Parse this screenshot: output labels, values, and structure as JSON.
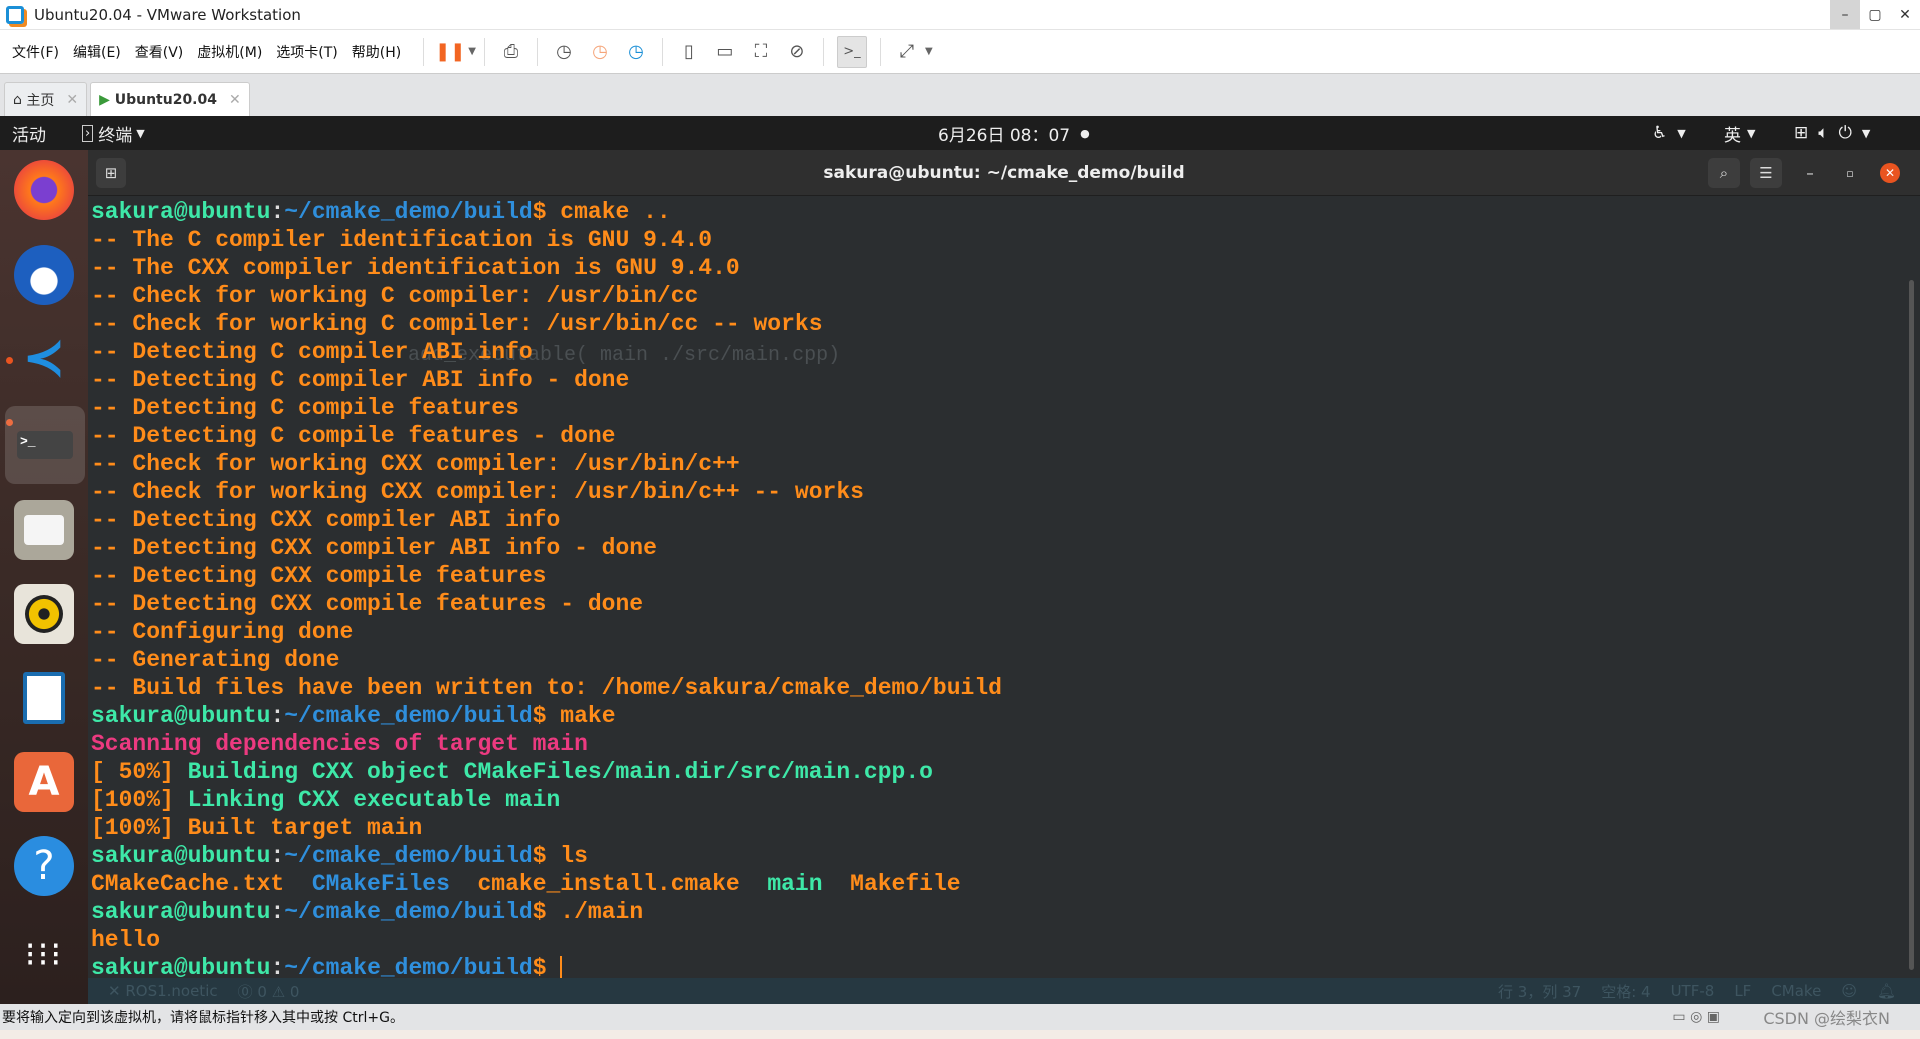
{
  "window": {
    "title": "Ubuntu20.04 - VMware Workstation",
    "controls": [
      "–",
      "▢",
      "✕"
    ]
  },
  "menu": [
    "文件(F)",
    "编辑(E)",
    "查看(V)",
    "虚拟机(M)",
    "选项卡(T)",
    "帮助(H)"
  ],
  "toolbar_icons": [
    "pause-icon",
    "send-ctrl-alt-del-icon",
    "snapshot-icon",
    "revert-snapshot-icon",
    "snapshot-manager-icon",
    "sidebar-view-icon",
    "thumbnail-view-icon",
    "fullscreen-icon",
    "unity-icon",
    "console-view-icon",
    "stretch-icon"
  ],
  "tabs": [
    {
      "label": "主页",
      "icon": "home-icon"
    },
    {
      "label": "Ubuntu20.04",
      "icon": "vm-icon",
      "active": true
    }
  ],
  "gnome": {
    "activities": "活动",
    "app_menu": "终端",
    "clock": "6月26日 08：07",
    "input_method": "英"
  },
  "terminal": {
    "title": "sakura@ubuntu: ~/cmake_demo/build",
    "ghost_text": "add_executable( main ./src/main.cpp)",
    "lines": [
      [
        [
          "g",
          "sakura@ubuntu"
        ],
        [
          "w",
          ":"
        ],
        [
          "b",
          "~/cmake_demo/build"
        ],
        [
          "o",
          "$ cmake .."
        ]
      ],
      [
        [
          "o",
          "-- The C compiler identification is GNU 9.4.0"
        ]
      ],
      [
        [
          "o",
          "-- The CXX compiler identification is GNU 9.4.0"
        ]
      ],
      [
        [
          "o",
          "-- Check for working C compiler: /usr/bin/cc"
        ]
      ],
      [
        [
          "o",
          "-- Check for working C compiler: /usr/bin/cc -- works"
        ]
      ],
      [
        [
          "o",
          "-- Detecting C compiler ABI info"
        ]
      ],
      [
        [
          "o",
          "-- Detecting C compiler ABI info - done"
        ]
      ],
      [
        [
          "o",
          "-- Detecting C compile features"
        ]
      ],
      [
        [
          "o",
          "-- Detecting C compile features - done"
        ]
      ],
      [
        [
          "o",
          "-- Check for working CXX compiler: /usr/bin/c++"
        ]
      ],
      [
        [
          "o",
          "-- Check for working CXX compiler: /usr/bin/c++ -- works"
        ]
      ],
      [
        [
          "o",
          "-- Detecting CXX compiler ABI info"
        ]
      ],
      [
        [
          "o",
          "-- Detecting CXX compiler ABI info - done"
        ]
      ],
      [
        [
          "o",
          "-- Detecting CXX compile features"
        ]
      ],
      [
        [
          "o",
          "-- Detecting CXX compile features - done"
        ]
      ],
      [
        [
          "o",
          "-- Configuring done"
        ]
      ],
      [
        [
          "o",
          "-- Generating done"
        ]
      ],
      [
        [
          "o",
          "-- Build files have been written to: /home/sakura/cmake_demo/build"
        ]
      ],
      [
        [
          "g",
          "sakura@ubuntu"
        ],
        [
          "w",
          ":"
        ],
        [
          "b",
          "~/cmake_demo/build"
        ],
        [
          "o",
          "$ make"
        ]
      ],
      [
        [
          "m",
          "Scanning dependencies of target main"
        ]
      ],
      [
        [
          "o",
          "[ 50%] "
        ],
        [
          "g",
          "Building CXX object CMakeFiles/main.dir/src/main.cpp.o"
        ]
      ],
      [
        [
          "o",
          "[100%] "
        ],
        [
          "g",
          "Linking CXX executable main"
        ]
      ],
      [
        [
          "o",
          "[100%] Built target main"
        ]
      ],
      [
        [
          "g",
          "sakura@ubuntu"
        ],
        [
          "w",
          ":"
        ],
        [
          "b",
          "~/cmake_demo/build"
        ],
        [
          "o",
          "$ ls"
        ]
      ],
      [
        [
          "o",
          "CMakeCache.txt  "
        ],
        [
          "b",
          "CMakeFiles"
        ],
        [
          "o",
          "  cmake_install.cmake  "
        ],
        [
          "g",
          "main"
        ],
        [
          "o",
          "  Makefile"
        ]
      ],
      [
        [
          "g",
          "sakura@ubuntu"
        ],
        [
          "w",
          ":"
        ],
        [
          "b",
          "~/cmake_demo/build"
        ],
        [
          "o",
          "$ ./main"
        ]
      ],
      [
        [
          "o",
          "hello"
        ]
      ],
      [
        [
          "g",
          "sakura@ubuntu"
        ],
        [
          "w",
          ":"
        ],
        [
          "b",
          "~/cmake_demo/build"
        ],
        [
          "o",
          "$ "
        ]
      ]
    ]
  },
  "vscode_status": {
    "left": [
      "✕ ROS1.noetic",
      "⓪ 0 ⚠ 0"
    ],
    "right": [
      "行 3，列 37",
      "空格: 4",
      "UTF-8",
      "LF",
      "CMake"
    ]
  },
  "vm_status": {
    "hint": "要将输入定向到该虚拟机，请将鼠标指针移入其中或按 Ctrl+G。",
    "watermark": "CSDN @绘梨衣N"
  },
  "colors": {
    "prompt_user": "#3ee8a8",
    "prompt_path": "#2f8fdc",
    "output": "#ff8c1a",
    "scanning": "#ec3a80",
    "terminal_bg": "#2b2e30",
    "ubuntu_orange": "#e95420"
  }
}
